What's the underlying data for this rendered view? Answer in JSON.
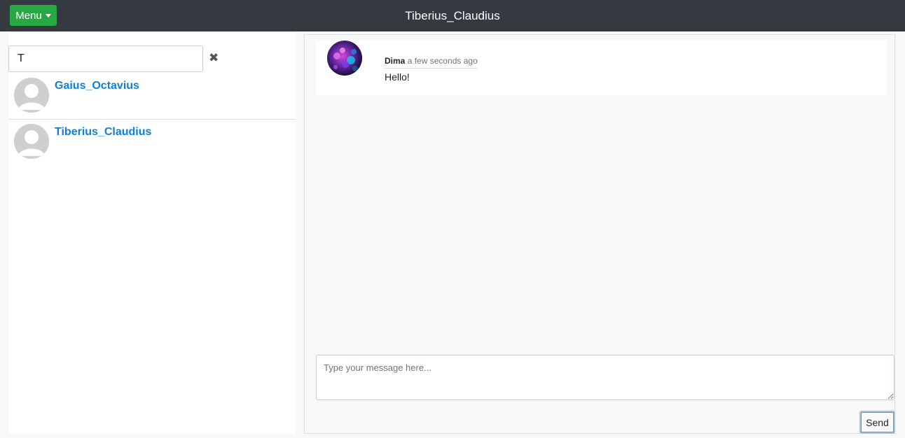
{
  "navbar": {
    "menu_label": "Menu",
    "title": "Tiberius_Claudius"
  },
  "sidebar": {
    "search_value": "T",
    "clear_icon": "close-icon",
    "users": [
      {
        "name": "Gaius_Octavius",
        "avatar": "default-avatar"
      },
      {
        "name": "Tiberius_Claudius",
        "avatar": "default-avatar"
      }
    ]
  },
  "chat": {
    "messages": [
      {
        "author": "Dima",
        "time": "a few seconds ago",
        "text": "Hello!",
        "avatar": "abstract-avatar"
      }
    ],
    "input_placeholder": "Type your message here...",
    "send_label": "Send"
  },
  "colors": {
    "navbar_bg": "#343a40",
    "menu_button": "#28a745",
    "username_link": "#0f7fd8"
  }
}
